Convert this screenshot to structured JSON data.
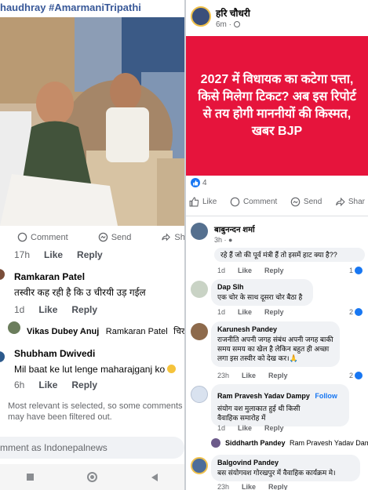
{
  "left": {
    "hashtags": "haudhray #AmarmaniTripathi",
    "actions": {
      "comment": "Comment",
      "send": "Send",
      "share": "Share"
    },
    "top_meta": {
      "time": "17h",
      "like": "Like",
      "reply": "Reply"
    },
    "comments": [
      {
        "name": "Ramkaran Patel",
        "text": "तस्वीर कह रही है कि उ चीरयी उड़ गईल",
        "time": "1d",
        "like": "Like",
        "reply": "Reply"
      },
      {
        "name": "Vikas Dubey Anuj",
        "mention": "Ramkaran Patel",
        "text": "चिरई वाप"
      },
      {
        "name": "Shubham Dwivedi",
        "text": "Mil baat ke lut lenge maharajganj ko",
        "time": "6h",
        "like": "Like",
        "reply": "Reply"
      }
    ],
    "filter_note": "Most relevant is selected, so some comments may have been filtered out.",
    "comment_as": "mment as Indonepalnews"
  },
  "right": {
    "author": "हरि चौधरी",
    "time": "6m · ",
    "headline": "2027 में  विधायक का कटेगा पत्ता, किसे मिलेगा टिकट? अब इस रिपोर्ट से तय होगी माननीयों की किस्मत, खबर BJP",
    "reaction_count": "4",
    "actions": {
      "like": "Like",
      "comment": "Comment",
      "send": "Send",
      "share": "Shar"
    },
    "comments": [
      {
        "name": "बाबुनन्दन शर्मा",
        "time": "3h · ",
        "text": "रहे हैं जो की पूर्व मंत्री हैं तो इसमें हाट क्या है??",
        "meta_time": "1d",
        "like": "Like",
        "reply": "Reply",
        "count": "1"
      },
      {
        "name": "Dap Slh",
        "text": "एक चोर के साथ दूसरा चोर बैठा है",
        "meta_time": "1d",
        "like": "Like",
        "reply": "Reply",
        "count": "2"
      },
      {
        "name": "Karunesh Pandey",
        "text": "राजनीति अपनी जगह संबंध अपनी जगह बाकी समय समय का खेल है लेकिन बहुत ही अच्छा लगा इस तस्वीर को देख कर।🙏",
        "meta_time": "23h",
        "like": "Like",
        "reply": "Reply",
        "count": "2"
      },
      {
        "name": "Ram Pravesh Yadav Dampy",
        "follow": "Follow",
        "text": "संयोग वश मुलाकात हुई थी किसी वैवाहिक समारोह में",
        "meta_time": "1d",
        "like": "Like",
        "reply": "Reply"
      },
      {
        "name": "Siddharth Pandey",
        "mention": "Ram Pravesh Yadav Dampy..."
      },
      {
        "name": "Balgovind Pandey",
        "text": "बस संयोगवश गोरखपुर में वैवाहिक कार्यक्रम मे।",
        "meta_time": "23h",
        "like": "Like",
        "reply": "Reply"
      }
    ]
  },
  "colors": {
    "accent": "#1877f2",
    "card": "#e6143c",
    "hashtag": "#385898"
  }
}
